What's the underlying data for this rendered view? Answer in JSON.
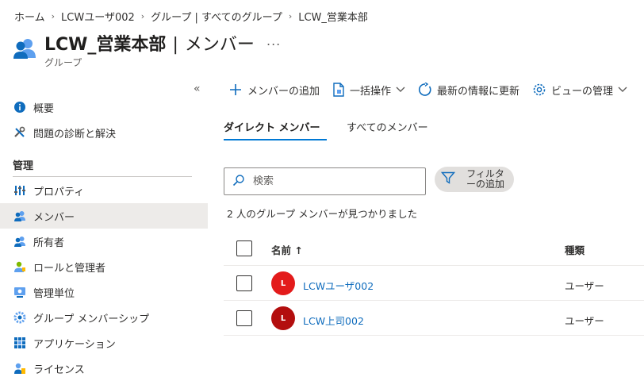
{
  "breadcrumb": [
    {
      "label": "ホーム"
    },
    {
      "label": "LCWユーザ002"
    },
    {
      "label": "グループ | すべてのグループ"
    },
    {
      "label": "LCW_営業本部"
    }
  ],
  "header": {
    "title": "LCW_営業本部",
    "separator": "|",
    "section": "メンバー",
    "more": "...",
    "subtitle": "グループ"
  },
  "sidebar": {
    "collapse_glyph": "«",
    "items_top": [
      {
        "label": "概要",
        "icon": "info-icon"
      },
      {
        "label": "問題の診断と解決",
        "icon": "wrench-icon"
      }
    ],
    "section_label": "管理",
    "items": [
      {
        "label": "プロパティ",
        "icon": "properties-icon"
      },
      {
        "label": "メンバー",
        "icon": "members-icon",
        "active": true
      },
      {
        "label": "所有者",
        "icon": "owners-icon"
      },
      {
        "label": "ロールと管理者",
        "icon": "roles-icon"
      },
      {
        "label": "管理単位",
        "icon": "admin-units-icon"
      },
      {
        "label": "グループ メンバーシップ",
        "icon": "group-membership-icon"
      },
      {
        "label": "アプリケーション",
        "icon": "applications-icon"
      },
      {
        "label": "ライセンス",
        "icon": "licenses-icon"
      }
    ]
  },
  "toolbar": {
    "add_member": "メンバーの追加",
    "bulk": "一括操作",
    "refresh": "最新の情報に更新",
    "view": "ビューの管理"
  },
  "tabs": [
    {
      "label": "ダイレクト メンバー",
      "active": true
    },
    {
      "label": "すべてのメンバー",
      "active": false
    }
  ],
  "search": {
    "placeholder": "検索",
    "value": ""
  },
  "filter": {
    "label_line1": "フィルタ",
    "label_line2": "ーの追加"
  },
  "result_count": "2 人のグループ メンバーが見つかりました",
  "table": {
    "columns": {
      "name": "名前 ↑",
      "type": "種類"
    },
    "rows": [
      {
        "initial": "L",
        "name": "LCWユーザ002",
        "type": "ユーザー",
        "avatar_color": "#e31b1b"
      },
      {
        "initial": "L",
        "name": "LCW上司002",
        "type": "ユーザー",
        "avatar_color": "#b30e0e"
      }
    ]
  },
  "colors": {
    "accent": "#0078d4",
    "link": "#0f6cbd",
    "active_nav": "#edebe9"
  }
}
